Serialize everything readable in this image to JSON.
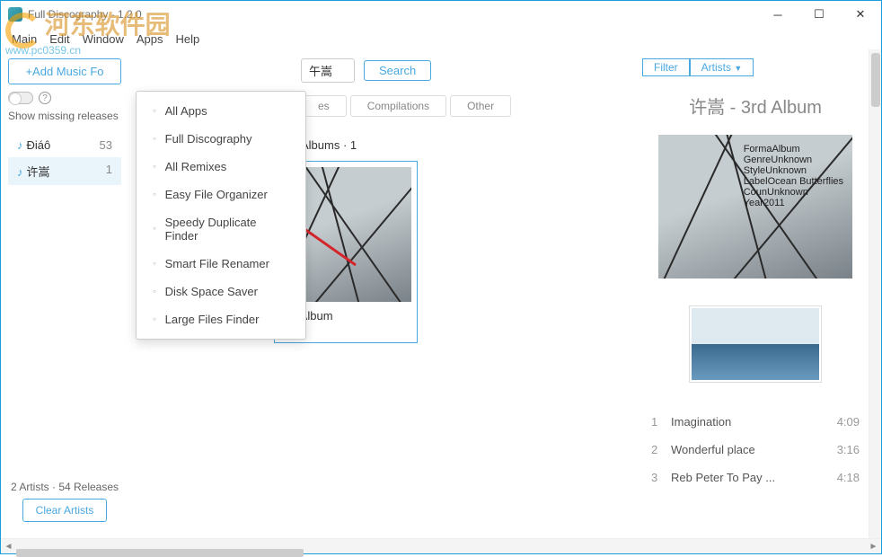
{
  "window": {
    "title": "Full Discography  -  1.2.0"
  },
  "watermark": {
    "name": "河东软件园",
    "url": "www.pc0359.cn"
  },
  "menu": {
    "main": "Main",
    "edit": "Edit",
    "window": "Window",
    "apps": "Apps",
    "help": "Help"
  },
  "apps_menu": [
    "All Apps",
    "Full Discography",
    "All Remixes",
    "Easy File Organizer",
    "Speedy Duplicate Finder",
    "Smart File Renamer",
    "Disk Space Saver",
    "Large Files Finder"
  ],
  "sidebar": {
    "add_button": "+Add Music Fo",
    "show_missing_label": "Show missing releases",
    "artists": [
      {
        "name": "Điáô",
        "count": "53"
      },
      {
        "name": "许嵩",
        "count": "1"
      }
    ],
    "footer_summary": "2 Artists · 54 Releases",
    "clear_button": "Clear Artists"
  },
  "center": {
    "search_value": "午嵩",
    "search_button": "Search",
    "tabs": [
      "es",
      "Compilations",
      "Other"
    ],
    "section_label": "Albums · 1",
    "albums": [
      {
        "title": "3rd Album",
        "year": "2011"
      }
    ]
  },
  "right": {
    "filter_label": "Filter",
    "filter_type": "Artists",
    "heading": "许嵩 - 3rd Album",
    "meta": {
      "format": {
        "k": "Forma",
        "v": "Album"
      },
      "genre": {
        "k": "Genre",
        "v": "Unknown"
      },
      "style": {
        "k": "Style",
        "v": "Unknown"
      },
      "label": {
        "k": "Label",
        "v": "Ocean Butterflies"
      },
      "country": {
        "k": "Coun",
        "v": "Unknown"
      },
      "year": {
        "k": "Year",
        "v": "2011"
      }
    },
    "tracks": [
      {
        "n": "1",
        "name": "Imagination",
        "dur": "4:09"
      },
      {
        "n": "2",
        "name": "Wonderful place",
        "dur": "3:16"
      },
      {
        "n": "3",
        "name": "Reb Peter To Pay ...",
        "dur": "4:18"
      }
    ]
  }
}
